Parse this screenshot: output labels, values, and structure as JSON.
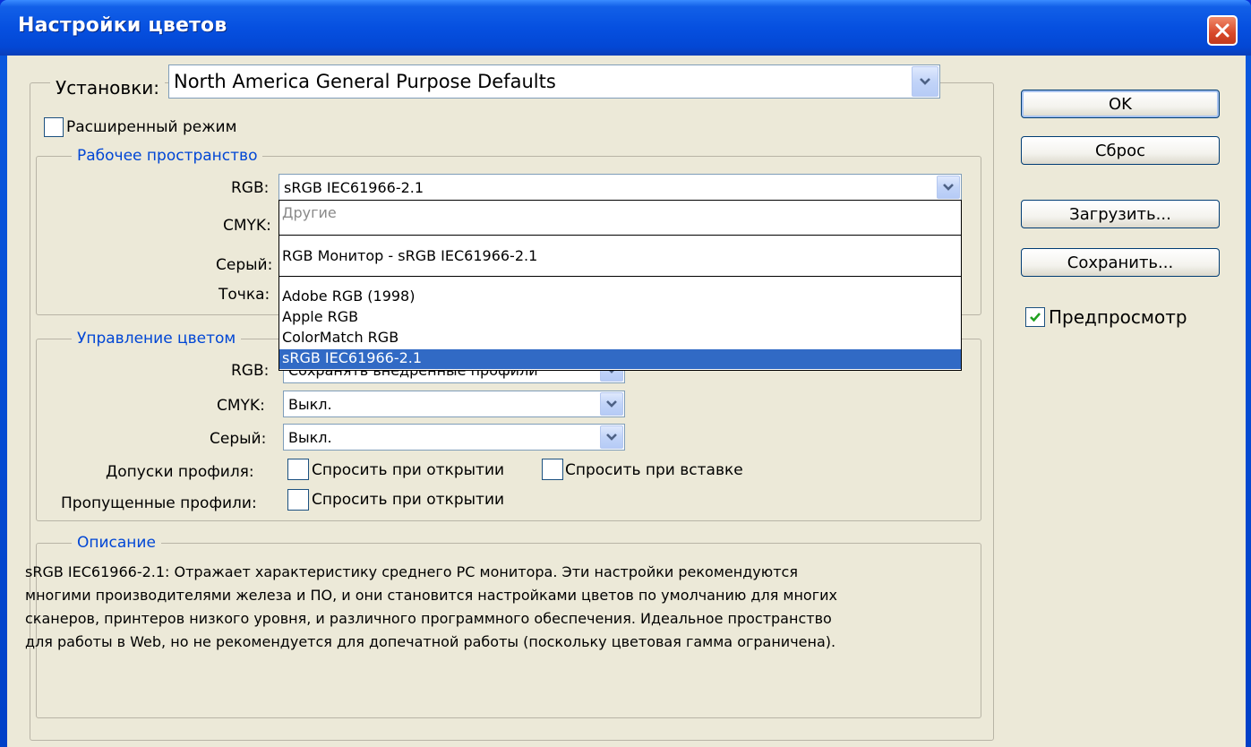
{
  "window": {
    "title": "Настройки цветов",
    "close_icon": "close-icon"
  },
  "settings": {
    "label": "Установки:",
    "value": "North America General Purpose Defaults"
  },
  "advanced_mode": {
    "label": "Расширенный режим",
    "checked": false
  },
  "working_spaces": {
    "title": "Рабочее пространство",
    "rgb_label": "RGB:",
    "rgb_value": "sRGB IEC61966-2.1",
    "cmyk_label": "CMYK:",
    "gray_label": "Серый:",
    "spot_label": "Точка:",
    "rgb_dropdown": {
      "group_others": "Другие",
      "monitor_rgb": "RGB Монитор - sRGB IEC61966-2.1",
      "options": [
        "Adobe RGB (1998)",
        "Apple RGB",
        "ColorMatch RGB",
        "sRGB IEC61966-2.1"
      ],
      "selected": "sRGB IEC61966-2.1"
    }
  },
  "color_management": {
    "title": "Управление цветом",
    "rgb_label": "RGB:",
    "rgb_value": "Сохранять внедренные профили",
    "cmyk_label": "CMYK:",
    "cmyk_value": "Выкл.",
    "gray_label": "Серый:",
    "gray_value": "Выкл.",
    "mismatch_label": "Допуски профиля:",
    "mismatch_open": "Спросить при открытии",
    "mismatch_paste": "Спросить при вставке",
    "missing_label": "Пропущенные профили:",
    "missing_open": "Спросить при открытии"
  },
  "description": {
    "title": "Описание",
    "lines": [
      "sRGB IEC61966-2.1: Отражает характеристику среднего PC монитора. Эти настройки рекомендуются",
      "многими производителями железа и ПО, и они становится настройками цветов по умолчанию для многих",
      "сканеров, принтеров низкого уровня, и различного программного обеспечения. Идеальное пространство",
      "для работы в Web, но не рекомендуется для допечатной работы (поскольку цветовая гамма ограничена)."
    ]
  },
  "buttons": {
    "ok": "OK",
    "reset": "Сброс",
    "load": "Загрузить...",
    "save": "Сохранить..."
  },
  "preview": {
    "label": "Предпросмотр",
    "checked": true
  },
  "colors": {
    "title_bar": "#0a56e0",
    "dialog_bg": "#ece9d8",
    "group_title": "#0046d5",
    "selection": "#316ac5"
  }
}
